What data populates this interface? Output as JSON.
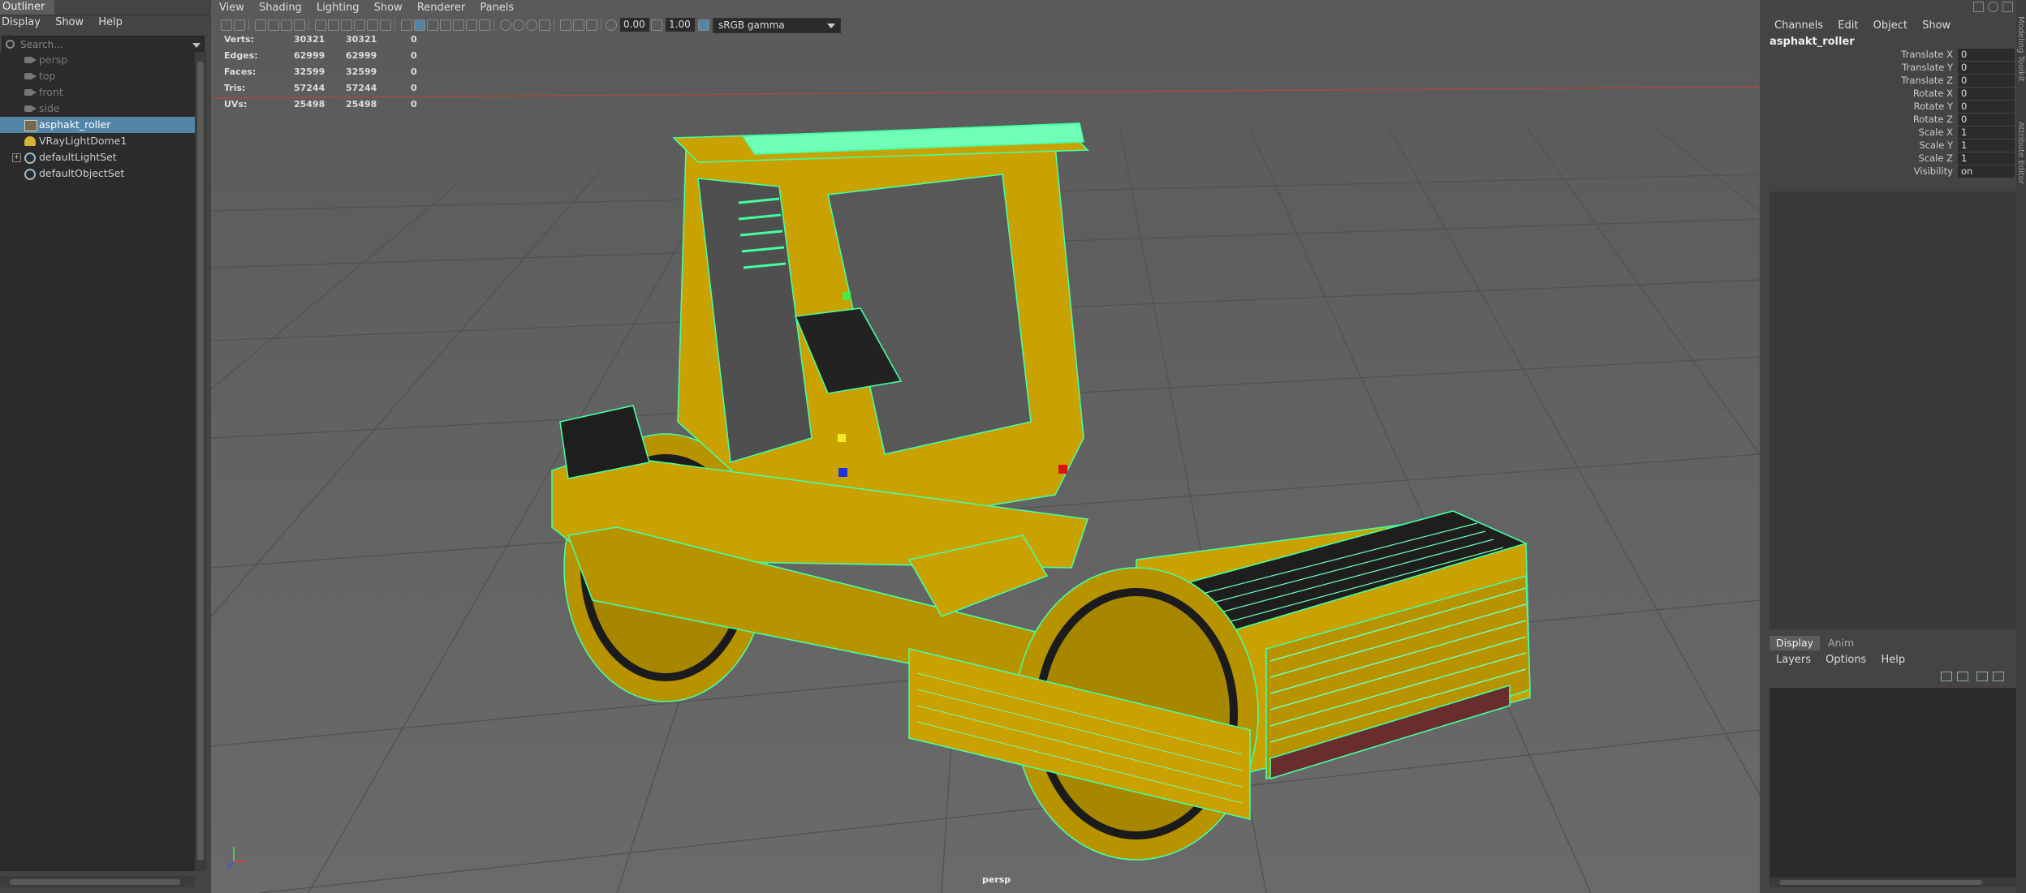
{
  "outliner": {
    "title": "Outliner",
    "menu": [
      "Display",
      "Show",
      "Help"
    ],
    "search_placeholder": "Search...",
    "items": [
      {
        "label": "persp",
        "type": "camera",
        "dim": true
      },
      {
        "label": "top",
        "type": "camera",
        "dim": true
      },
      {
        "label": "front",
        "type": "camera",
        "dim": true
      },
      {
        "label": "side",
        "type": "camera",
        "dim": true
      },
      {
        "label": "asphakt_roller",
        "type": "mesh",
        "selected": true
      },
      {
        "label": "VRayLightDome1",
        "type": "light"
      },
      {
        "label": "defaultLightSet",
        "type": "set",
        "expandable": true
      },
      {
        "label": "defaultObjectSet",
        "type": "set"
      }
    ]
  },
  "viewport": {
    "menu": [
      "View",
      "Shading",
      "Lighting",
      "Show",
      "Renderer",
      "Panels"
    ],
    "exposure": "0.00",
    "gamma": "1.00",
    "color_space": "sRGB gamma",
    "camera_label": "persp",
    "hud": [
      {
        "name": "Verts:",
        "a": "30321",
        "b": "30321",
        "c": "0"
      },
      {
        "name": "Edges:",
        "a": "62999",
        "b": "62999",
        "c": "0"
      },
      {
        "name": "Faces:",
        "a": "32599",
        "b": "32599",
        "c": "0"
      },
      {
        "name": "Tris:",
        "a": "57244",
        "b": "57244",
        "c": "0"
      },
      {
        "name": "UVs:",
        "a": "25498",
        "b": "25498",
        "c": "0"
      }
    ],
    "colors": {
      "body": "#c9a100",
      "wire": "#44ffa0",
      "grid": "#555555",
      "background": "#5f5f5f"
    }
  },
  "channel_box": {
    "menu": [
      "Channels",
      "Edit",
      "Object",
      "Show"
    ],
    "object_name": "asphakt_roller",
    "attributes": [
      {
        "name": "Translate X",
        "value": "0"
      },
      {
        "name": "Translate Y",
        "value": "0"
      },
      {
        "name": "Translate Z",
        "value": "0"
      },
      {
        "name": "Rotate X",
        "value": "0"
      },
      {
        "name": "Rotate Y",
        "value": "0"
      },
      {
        "name": "Rotate Z",
        "value": "0"
      },
      {
        "name": "Scale X",
        "value": "1"
      },
      {
        "name": "Scale Y",
        "value": "1"
      },
      {
        "name": "Scale Z",
        "value": "1"
      },
      {
        "name": "Visibility",
        "value": "on"
      }
    ]
  },
  "layer_editor": {
    "tabs": [
      "Display",
      "Anim"
    ],
    "menu": [
      "Layers",
      "Options",
      "Help"
    ]
  }
}
